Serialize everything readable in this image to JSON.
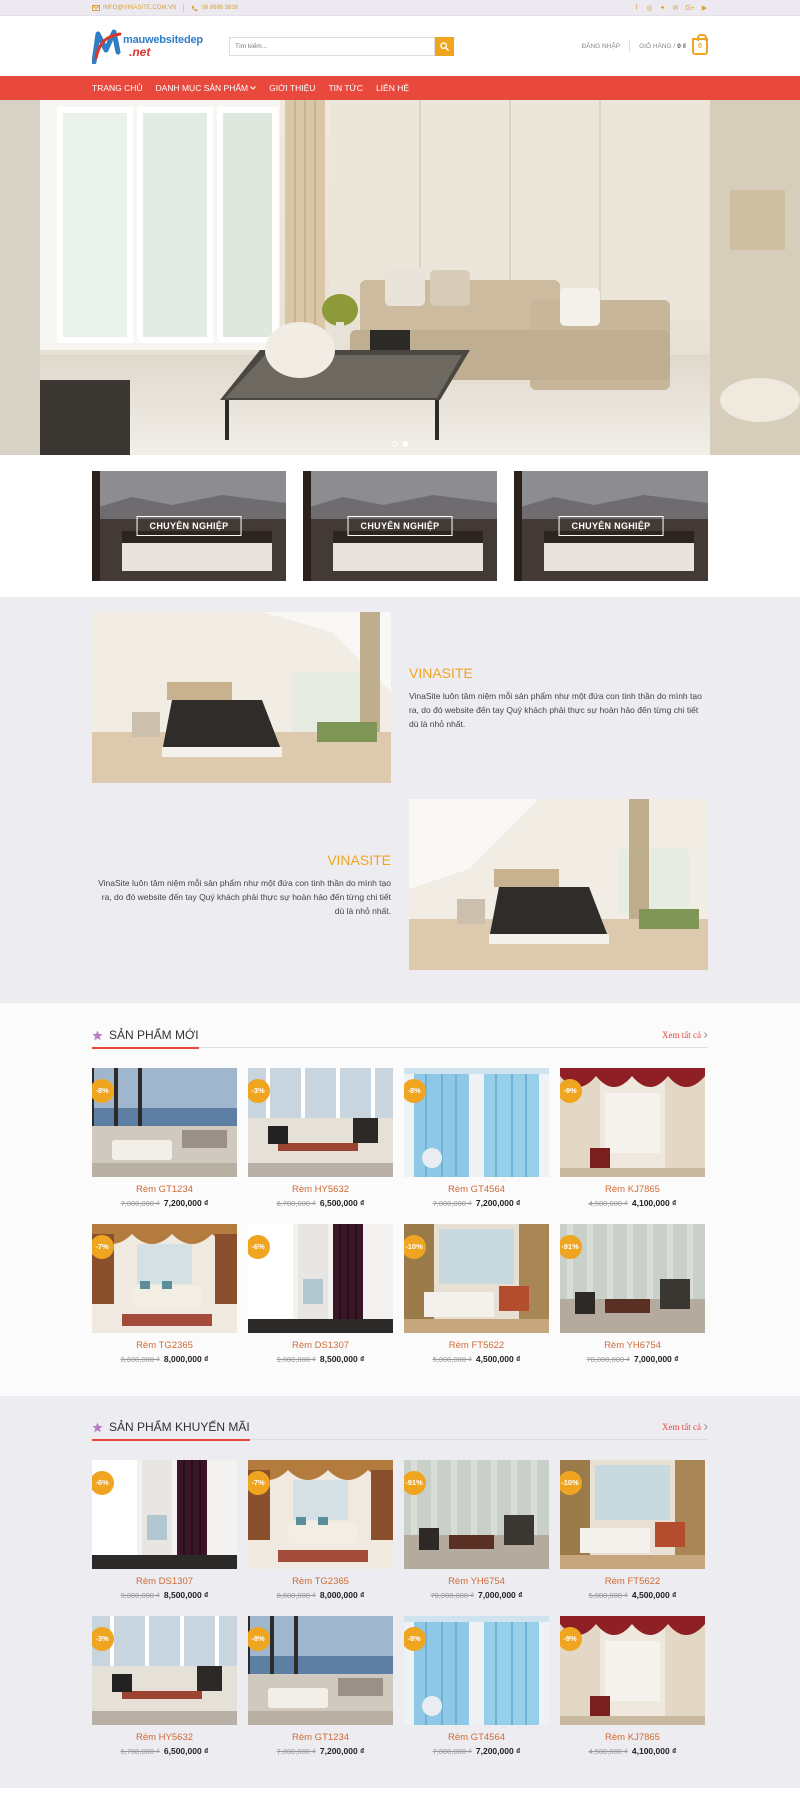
{
  "topbar": {
    "email": "INFO@VINASITE.COM.VN",
    "phone": "08 8686 3838",
    "icons": [
      "facebook-icon",
      "instagram-icon",
      "twitter-icon",
      "email-icon",
      "googleplus-icon",
      "youtube-icon"
    ]
  },
  "header": {
    "logo_line1": "mauwebsitedep",
    "logo_line2": ".net",
    "search_placeholder": "Tìm kiếm...",
    "login": "ĐĂNG NHẬP",
    "cart_label": "GIỎ HÀNG /",
    "cart_total": "0 ₫",
    "cart_count": "0"
  },
  "nav": {
    "items": [
      "TRANG CHỦ",
      "DANH MỤC SẢN PHẨM",
      "GIỚI THIỆU",
      "TIN TỨC",
      "LIÊN HỆ"
    ]
  },
  "banners": [
    "CHUYÊN NGHIỆP",
    "CHUYÊN NGHIỆP",
    "CHUYÊN NGHIỆP"
  ],
  "about": [
    {
      "title": "VINASITE",
      "text": "VinaSite luôn tâm niệm mỗi sản phẩm như một đứa con tinh thần do mình tạo ra, do đó website đến tay Quý khách phải thực sự hoàn hảo đến từng chi tiết dù là nhỏ nhất."
    },
    {
      "title": "VINASITE",
      "text": "VinaSite luôn tâm niệm mỗi sản phẩm như một đứa con tinh thần do mình tạo ra, do đó website đến tay Quý khách phải thực sự hoàn hảo đến từng chi tiết dù là nhỏ nhất."
    }
  ],
  "new_products": {
    "title": "SẢN PHẨM MỚI",
    "view_all": "Xem tất cả",
    "items": [
      {
        "badge": "-8%",
        "name": "Rèm GT1234",
        "old": "7,800,000 ₫",
        "price": "7,200,000 ₫",
        "img": "ocean"
      },
      {
        "badge": "-3%",
        "name": "Rèm HY5632",
        "old": "6,700,000 ₫",
        "price": "6,500,000 ₫",
        "img": "office"
      },
      {
        "badge": "-8%",
        "name": "Rèm GT4564",
        "old": "7,800,000 ₫",
        "price": "7,200,000 ₫",
        "img": "blue"
      },
      {
        "badge": "-9%",
        "name": "Rèm KJ7865",
        "old": "4,500,000 ₫",
        "price": "4,100,000 ₫",
        "img": "red"
      },
      {
        "badge": "-7%",
        "name": "Rèm TG2365",
        "old": "8,600,000 ₫",
        "price": "8,000,000 ₫",
        "img": "sofa"
      },
      {
        "badge": "-6%",
        "name": "Rèm DS1307",
        "old": "9,000,000 ₫",
        "price": "8,500,000 ₫",
        "img": "purple"
      },
      {
        "badge": "-10%",
        "name": "Rèm FT5622",
        "old": "5,000,000 ₫",
        "price": "4,500,000 ₫",
        "img": "bedroom"
      },
      {
        "badge": "-91%",
        "name": "Rèm YH6754",
        "old": "78,000,000 ₫",
        "price": "7,000,000 ₫",
        "img": "sheer"
      }
    ]
  },
  "sale_products": {
    "title": "SẢN PHẨM KHUYẾN MÃI",
    "view_all": "Xem tất cả",
    "items": [
      {
        "badge": "-6%",
        "name": "Rèm DS1307",
        "old": "9,000,000 ₫",
        "price": "8,500,000 ₫",
        "img": "purple"
      },
      {
        "badge": "-7%",
        "name": "Rèm TG2365",
        "old": "8,600,000 ₫",
        "price": "8,000,000 ₫",
        "img": "sofa"
      },
      {
        "badge": "-91%",
        "name": "Rèm YH6754",
        "old": "78,000,000 ₫",
        "price": "7,000,000 ₫",
        "img": "sheer"
      },
      {
        "badge": "-10%",
        "name": "Rèm FT5622",
        "old": "5,000,000 ₫",
        "price": "4,500,000 ₫",
        "img": "bedroom"
      },
      {
        "badge": "-3%",
        "name": "Rèm HY5632",
        "old": "6,700,000 ₫",
        "price": "6,500,000 ₫",
        "img": "office"
      },
      {
        "badge": "-8%",
        "name": "Rèm GT1234",
        "old": "7,800,000 ₫",
        "price": "7,200,000 ₫",
        "img": "ocean"
      },
      {
        "badge": "-8%",
        "name": "Rèm GT4564",
        "old": "7,800,000 ₫",
        "price": "7,200,000 ₫",
        "img": "blue"
      },
      {
        "badge": "-9%",
        "name": "Rèm KJ7865",
        "old": "4,500,000 ₫",
        "price": "4,100,000 ₫",
        "img": "red"
      }
    ]
  },
  "colors": {
    "accent": "#e9483d",
    "gold": "#f0a521",
    "product_name": "#d06a34"
  }
}
